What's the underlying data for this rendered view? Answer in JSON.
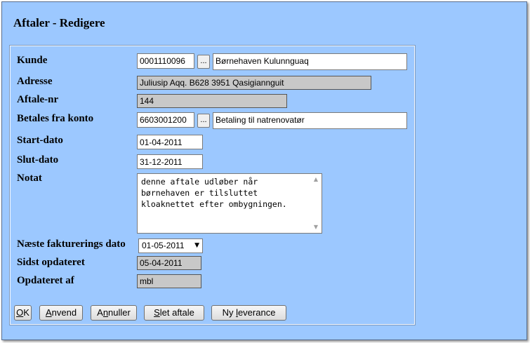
{
  "title": "Aftaler - Redigere",
  "labels": {
    "kunde": "Kunde",
    "adresse": "Adresse",
    "aftale_nr": "Aftale-nr",
    "betales_fra_konto": "Betales fra konto",
    "start_dato": "Start-dato",
    "slut_dato": "Slut-dato",
    "notat": "Notat",
    "naeste_fakturerings_dato": "Næste fakturerings dato",
    "sidst_opdateret": "Sidst opdateret",
    "opdateret_af": "Opdateret af"
  },
  "fields": {
    "kunde_nr": "0001110096",
    "kunde_lookup": "...",
    "kunde_navn": "Børnehaven Kulunnguaq",
    "adresse": "Juliusip Aqq. B628 3951  Qasigiannguit",
    "aftale_nr": "144",
    "konto_nr": "6603001200",
    "konto_lookup": "...",
    "konto_navn": "Betaling til natrenovatør",
    "start_dato": "01-04-2011",
    "slut_dato": "31-12-2011",
    "notat": "denne aftale udløber når børnehaven er tilsluttet kloaknettet efter ombygningen.",
    "naeste_fakturerings_dato": "01-05-2011",
    "sidst_opdateret": "05-04-2011",
    "opdateret_af": "mbl"
  },
  "buttons": {
    "ok_u": "O",
    "ok_rest": "K",
    "anvend_u": "A",
    "anvend_rest": "nvend",
    "annuller_pre": "A",
    "annuller_u": "n",
    "annuller_rest": "nuller",
    "slet_u": "S",
    "slet_rest": "let aftale",
    "ny_pre": "Ny ",
    "ny_u": "l",
    "ny_rest": "everance"
  }
}
